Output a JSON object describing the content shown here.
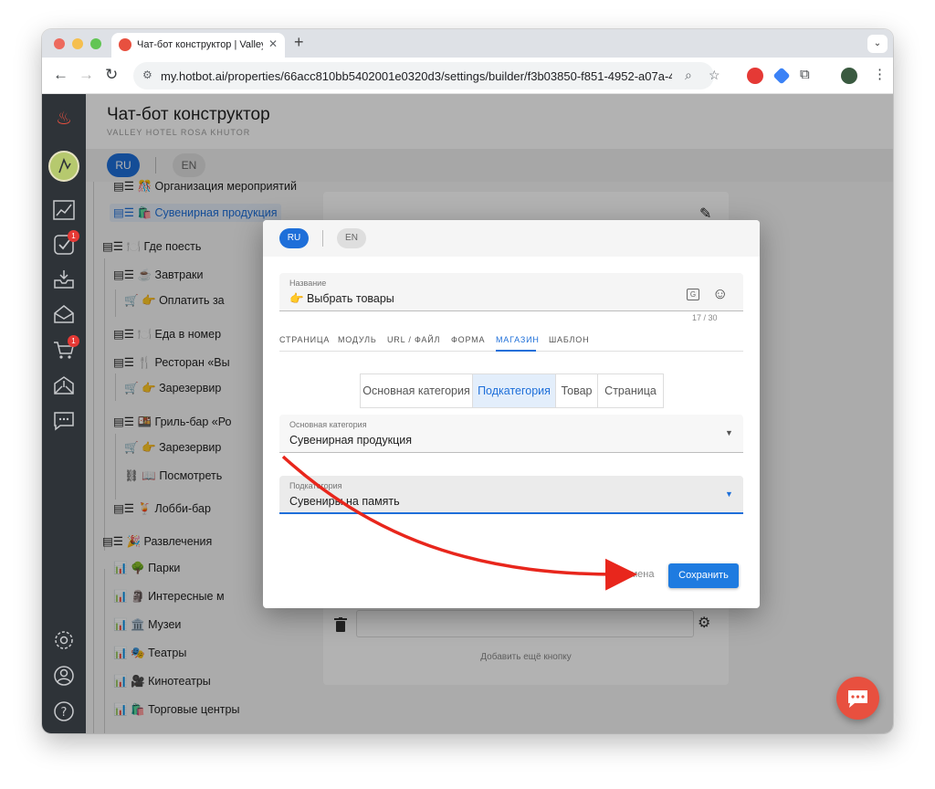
{
  "browser": {
    "tab_title": "Чат-бот конструктор | Valley",
    "new_tab": "+",
    "tab_close": "✕",
    "url": "my.hotbot.ai/properties/66acc810bb5402001e0320d3/settings/builder/f3b03850-f851-4952-a07a-4...",
    "colors": {
      "close": "#ed6a5e",
      "min": "#f5bf4f",
      "max": "#62c554"
    }
  },
  "app": {
    "title": "Чат-бот конструктор",
    "subtitle": "VALLEY HOTEL ROSA KHUTOR",
    "lang_ru": "RU",
    "lang_en": "EN",
    "accent": "#1e6fd9",
    "badges": {
      "tasks": "1",
      "orders": "1"
    }
  },
  "tree": {
    "items": [
      {
        "label": "▤☰ 🎊 Организация мероприятий"
      },
      {
        "label": "▤☰ 🛍️ Сувенирная продукция"
      },
      {
        "label": "▤☰ 🍽️ Где поесть"
      },
      {
        "label": "▤☰ ☕ Завтраки"
      },
      {
        "label": "🛒 👉 Оплатить за"
      },
      {
        "label": "▤☰ 🍽️ Еда в номер"
      },
      {
        "label": "▤☰ 🍴 Ресторан «Вы"
      },
      {
        "label": "🛒 👉 Зарезервир"
      },
      {
        "label": "▤☰ 🍱 Гриль-бар «Ро"
      },
      {
        "label": "🛒 👉 Зарезервир"
      },
      {
        "label": "⛓ 📖 Посмотреть"
      },
      {
        "label": "▤☰ 🍹 Лобби-бар"
      },
      {
        "label": "▤☰ 🎉 Развлечения"
      },
      {
        "label": "📊 🌳 Парки"
      },
      {
        "label": "📊 🗿 Интересные м"
      },
      {
        "label": "📊 🏛️ Музеи"
      },
      {
        "label": "📊 🎭 Театры"
      },
      {
        "label": "📊 🎥 Кинотеатры"
      },
      {
        "label": "📊 🛍️ Торговые центры"
      }
    ]
  },
  "panel": {
    "add_more": "Добавить ещё кнопку"
  },
  "dialog": {
    "lang_ru": "RU",
    "lang_en": "EN",
    "name_label": "Название",
    "name_value": "👉 Выбрать товары",
    "counter": "17 / 30",
    "tabs": [
      "СТРАНИЦА",
      "МОДУЛЬ",
      "URL / ФАЙЛ",
      "ФОРМА",
      "МАГАЗИН",
      "ШАБЛОН"
    ],
    "active_tab": "МАГАЗИН",
    "segments": [
      "Основная категория",
      "Подкатегория",
      "Товар",
      "Страница"
    ],
    "active_segment": "Подкатегория",
    "main_category_label": "Основная категория",
    "main_category_value": "Сувенирная продукция",
    "subcategory_label": "Подкатегория",
    "subcategory_value": "Сувениры на память",
    "cancel": "Отмена",
    "save": "Сохранить"
  },
  "icons": {
    "sidebar": [
      "flame-logo-icon",
      "chart-icon",
      "tasks-icon",
      "inbox-icon",
      "mailbox-icon",
      "cart-icon",
      "mail-open-icon",
      "chat-icon",
      "settings-icon",
      "account-icon",
      "help-icon"
    ]
  },
  "annotation": {
    "arrow_color": "#e8261c"
  }
}
